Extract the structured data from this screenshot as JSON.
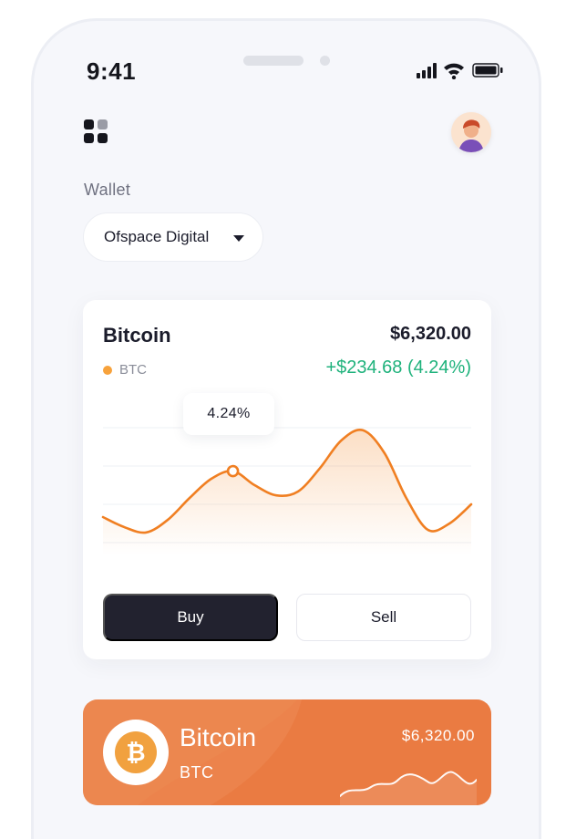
{
  "status_bar": {
    "time": "9:41",
    "icons": [
      "signal-icon",
      "wifi-icon",
      "battery-icon"
    ]
  },
  "header": {
    "menu_icon": "grid-menu-icon",
    "avatar_icon": "user-avatar"
  },
  "wallet": {
    "label": "Wallet",
    "selected": "Ofspace Digital"
  },
  "asset_card": {
    "name": "Bitcoin",
    "symbol": "BTC",
    "price": "$6,320.00",
    "change": "+$234.68 (4.24%)",
    "tooltip": "4.24%",
    "colors": {
      "accent": "#f07f22",
      "positive": "#1fb27c",
      "dot": "#f7a23b"
    },
    "chart_data": {
      "type": "area",
      "values": [
        0.3,
        0.22,
        0.18,
        0.28,
        0.45,
        0.6,
        0.66,
        0.55,
        0.47,
        0.5,
        0.68,
        0.9,
        0.98,
        0.8,
        0.45,
        0.2,
        0.25,
        0.4
      ],
      "highlight_index": 6,
      "grid": true
    },
    "buy_label": "Buy",
    "sell_label": "Sell"
  },
  "promo_card": {
    "name": "Bitcoin",
    "symbol": "BTC",
    "price": "$6,320.00",
    "coin_glyph": "₿",
    "background": "#ea8249"
  }
}
